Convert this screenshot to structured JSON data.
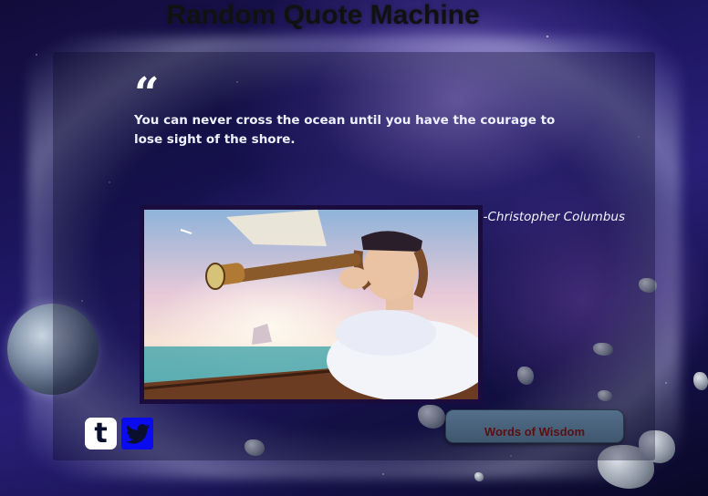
{
  "app": {
    "title": "Random Quote Machine"
  },
  "quote": {
    "text": "You can never cross the ocean until you have the courage to lose sight of the shore.",
    "author": "-Christopher Columbus",
    "quote_icon": "quote-left-icon"
  },
  "image": {
    "subject": "Explorer with spyglass on ship"
  },
  "share": {
    "tumblr_icon": "tumblr-icon",
    "tumblr_glyph": "t",
    "twitter_icon": "twitter-icon"
  },
  "buttons": {
    "new_quote_label": "Words of Wisdom"
  },
  "colors": {
    "title": "#111111",
    "quote_text": "#eef0ff",
    "button_bg": "#4a6580",
    "button_text": "#5a0f12",
    "tumblr_bg": "#ffffff",
    "twitter_bg": "#0b0bf0"
  }
}
